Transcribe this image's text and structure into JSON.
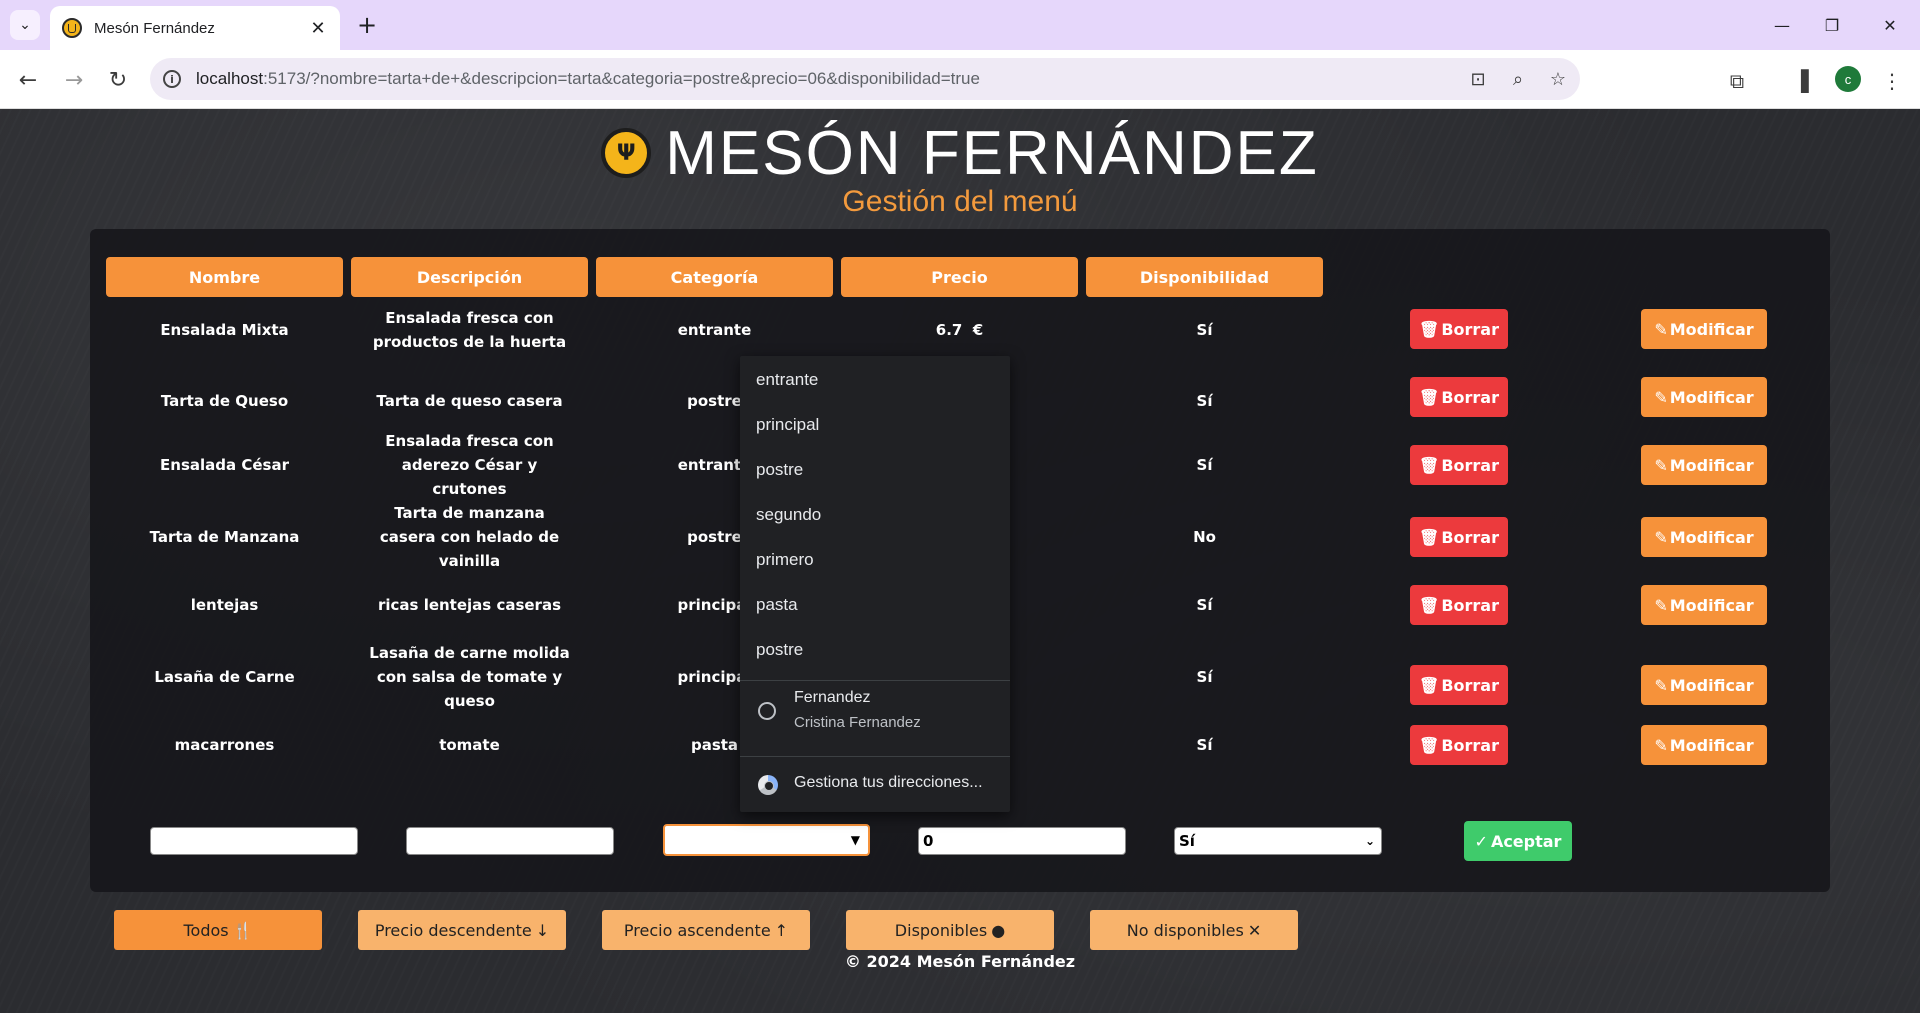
{
  "browser": {
    "tab_title": "Mesón Fernández",
    "url_host": "localhost",
    "url_rest": ":5173/?nombre=tarta+de+&descripcion=tarta&categoria=postre&precio=06&disponibilidad=true",
    "profile_initial": "c"
  },
  "header": {
    "brand": "MESÓN FERNÁNDEZ",
    "subtitle": "Gestión del menú"
  },
  "table": {
    "columns": [
      "Nombre",
      "Descripción",
      "Categoría",
      "Precio",
      "Disponibilidad"
    ],
    "rows": [
      {
        "nombre": "Ensalada Mixta",
        "descripcion": "Ensalada fresca con productos de la huerta",
        "categoria": "entrante",
        "precio": "6.7  €",
        "disponible": "Sí"
      },
      {
        "nombre": "Tarta de Queso",
        "descripcion": "Tarta de queso casera",
        "categoria": "postre",
        "precio": "",
        "disponible": "Sí"
      },
      {
        "nombre": "Ensalada César",
        "descripcion": "Ensalada fresca con aderezo César y crutones",
        "categoria": "entrante",
        "precio": "",
        "disponible": "Sí"
      },
      {
        "nombre": "Tarta de Manzana",
        "descripcion": "Tarta de manzana casera con helado de vainilla",
        "categoria": "postre",
        "precio": "",
        "disponible": "No"
      },
      {
        "nombre": "lentejas",
        "descripcion": "ricas lentejas caseras",
        "categoria": "principal",
        "precio": "",
        "disponible": "Sí"
      },
      {
        "nombre": "Lasaña de Carne",
        "descripcion": "Lasaña de carne molida con salsa de tomate y queso",
        "categoria": "principal",
        "precio": "",
        "disponible": "Sí"
      },
      {
        "nombre": "macarrones",
        "descripcion": "tomate",
        "categoria": "pasta",
        "precio": "",
        "disponible": "Sí"
      }
    ],
    "borrar_label": "Borrar",
    "modificar_label": "Modificar"
  },
  "form": {
    "nombre_value": "",
    "descripcion_value": "",
    "categoria_value": "",
    "precio_value": "0",
    "disponibilidad_value": "Sí",
    "aceptar_label": "Aceptar"
  },
  "filters": {
    "todos": "Todos",
    "precio_desc": "Precio descendente",
    "precio_asc": "Precio ascendente",
    "disponibles": "Disponibles",
    "no_disponibles": "No disponibles"
  },
  "footer": "© 2024 Mesón Fernández",
  "autofill": {
    "options": [
      "entrante",
      "principal",
      "postre",
      "segundo",
      "primero",
      "pasta",
      "postre"
    ],
    "profile_name": "Fernandez",
    "profile_full": "Cristina Fernandez",
    "manage": "Gestiona tus direcciones..."
  },
  "colors": {
    "accent": "#f6923a",
    "danger": "#ec3a3d",
    "success": "#3fcb6b",
    "subtitle": "#f39a3d"
  }
}
